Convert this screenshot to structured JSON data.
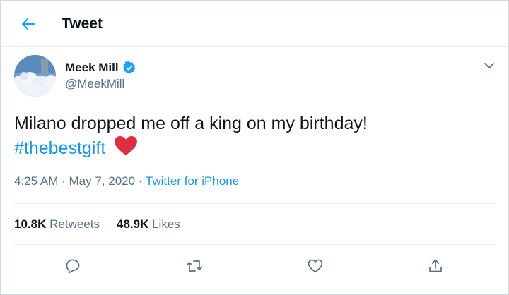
{
  "header": {
    "title": "Tweet",
    "back_icon": "arrow-left-icon"
  },
  "author": {
    "display_name": "Meek Mill",
    "handle": "@MeekMill",
    "verified": true,
    "verified_color": "#1da1f2"
  },
  "tweet": {
    "text": "Milano dropped me off a king on my birthday!",
    "hashtag": "#thebestgift",
    "emoji": "heart-emoji"
  },
  "meta": {
    "time": "4:25 AM",
    "separator": "·",
    "date": "May 7, 2020",
    "source": "Twitter for iPhone"
  },
  "stats": {
    "retweets_count": "10.8K",
    "retweets_label": "Retweets",
    "likes_count": "48.9K",
    "likes_label": "Likes"
  },
  "actions": [
    "reply-icon",
    "retweet-icon",
    "like-icon",
    "share-icon"
  ],
  "colors": {
    "accent": "#1b95e0",
    "secondary_text": "#5b7083",
    "heart": "#e0245e"
  }
}
